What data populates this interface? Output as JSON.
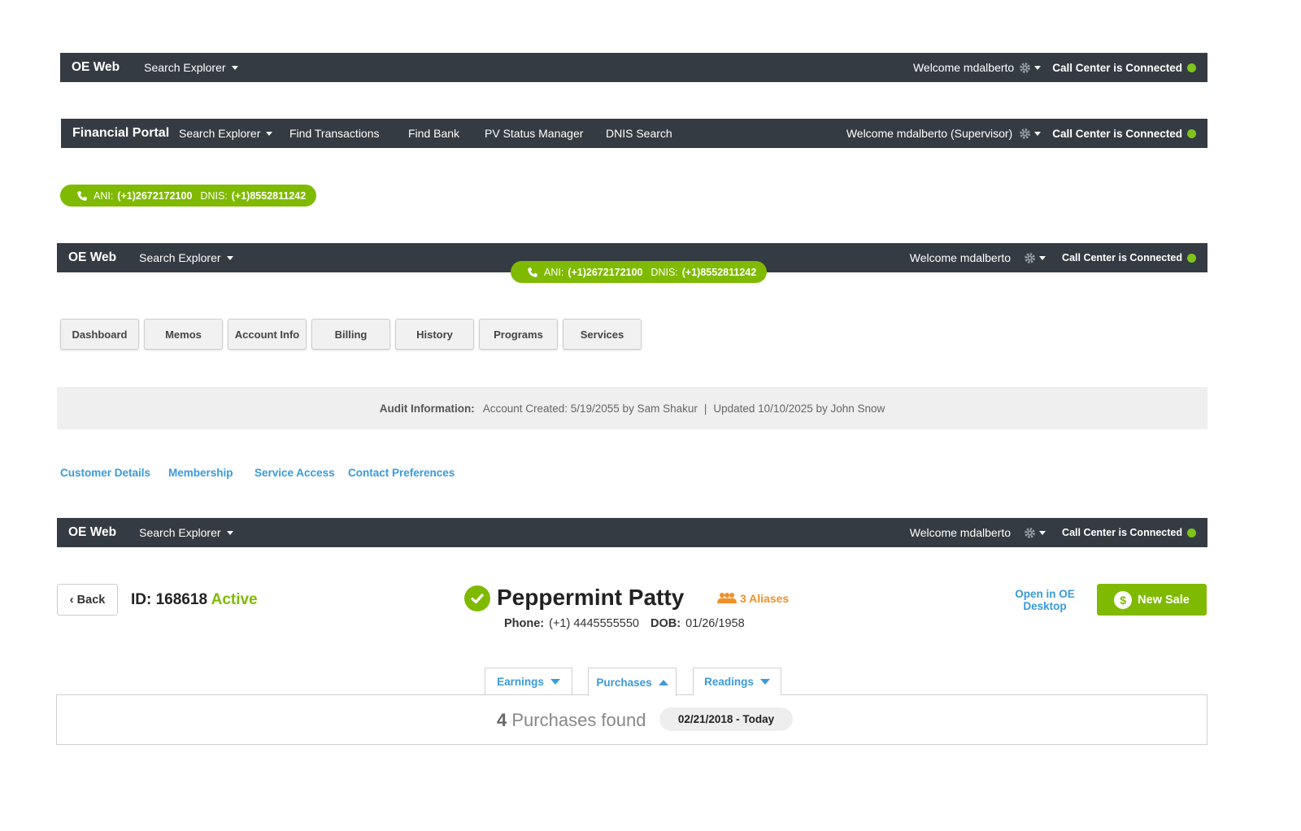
{
  "colors": {
    "nav_bg": "#353b42",
    "accent_green": "#7fba00",
    "link_blue": "#3a9ad9",
    "alias_orange": "#f0902a",
    "status_dot": "#7fc41c"
  },
  "navbar1": {
    "brand": "OE Web",
    "search": "Search Explorer",
    "welcome": "Welcome mdalberto",
    "status": "Call Center is Connected"
  },
  "navbar2": {
    "brand": "Financial Portal",
    "items": [
      "Search Explorer",
      "Find Transactions",
      "Find Bank",
      "PV Status Manager",
      "DNIS Search"
    ],
    "welcome": "Welcome mdalberto (Supervisor)",
    "status": "Call Center is Connected"
  },
  "call_pill": {
    "ani_label": "ANI:",
    "ani": "(+1)2672172100",
    "dnis_label": "DNIS:",
    "dnis": "(+1)8552811242"
  },
  "navbar3": {
    "brand": "OE Web",
    "search": "Search Explorer",
    "welcome": "Welcome mdalberto",
    "status": "Call Center is Connected"
  },
  "call_pill2": {
    "ani_label": "ANI:",
    "ani": "(+1)2672172100",
    "dnis_label": "DNIS:",
    "dnis": "(+1)8552811242"
  },
  "tabs": [
    "Dashboard",
    "Memos",
    "Account Info",
    "Billing",
    "History",
    "Programs",
    "Services"
  ],
  "audit": {
    "label": "Audit Information:",
    "created": "Account Created: 5/19/2055 by Sam Shakur",
    "sep": "|",
    "updated": "Updated 10/10/2025 by John Snow"
  },
  "sublinks": [
    "Customer Details",
    "Membership",
    "Service Access",
    "Contact Preferences"
  ],
  "navbar4": {
    "brand": "OE Web",
    "search": "Search Explorer",
    "welcome": "Welcome mdalberto",
    "status": "Call Center is Connected"
  },
  "customer": {
    "back": "Back",
    "id_label": "ID: 168618",
    "status": "Active",
    "name": "Peppermint Patty",
    "aliases": "3 Aliases",
    "phone_label": "Phone:",
    "phone": "(+1) 4445555550",
    "dob_label": "DOB:",
    "dob": "01/26/1958",
    "open_oe": "Open in OE Desktop",
    "new_sale": "New Sale"
  },
  "panel_tabs": [
    {
      "label": "Earnings",
      "state": "collapsed"
    },
    {
      "label": "Purchases",
      "state": "expanded"
    },
    {
      "label": "Readings",
      "state": "collapsed"
    }
  ],
  "results": {
    "count": "4",
    "text": "Purchases found",
    "range": "02/21/2018 - Today"
  }
}
